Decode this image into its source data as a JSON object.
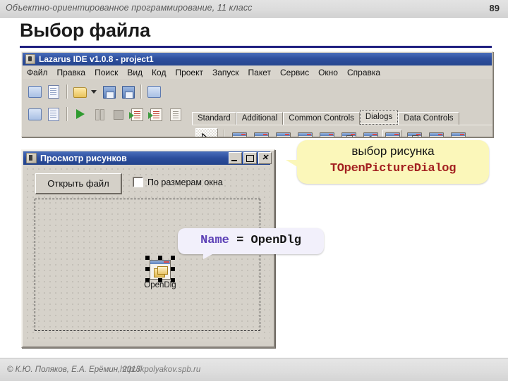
{
  "header": {
    "subject": "Объектно-ориентированное программирование, 11 класс",
    "page_number": "89"
  },
  "slide": {
    "title": "Выбор файла"
  },
  "footer": {
    "copyright": "© К.Ю. Поляков, Е.А. Ерёмин, 2013",
    "url": "http://kpolyakov.spb.ru"
  },
  "ide": {
    "title": "Lazarus IDE v1.0.8 - project1",
    "menu": [
      {
        "label": "Файл"
      },
      {
        "label": "Правка"
      },
      {
        "label": "Поиск"
      },
      {
        "label": "Вид"
      },
      {
        "label": "Код"
      },
      {
        "label": "Проект"
      },
      {
        "label": "Запуск"
      },
      {
        "label": "Пакет"
      },
      {
        "label": "Сервис"
      },
      {
        "label": "Окно"
      },
      {
        "label": "Справка"
      }
    ],
    "palette": {
      "tabs": [
        {
          "label": "Standard",
          "selected": false
        },
        {
          "label": "Additional",
          "selected": false
        },
        {
          "label": "Common Controls",
          "selected": false
        },
        {
          "label": "Dialogs",
          "selected": true
        },
        {
          "label": "Data Controls",
          "selected": false
        }
      ],
      "pointer_tool": "arrow-pointer-icon",
      "items": [
        {
          "name": "open-dialog-icon",
          "selected": false
        },
        {
          "name": "save-dialog-icon",
          "selected": false
        },
        {
          "name": "select-directory-dialog-icon",
          "selected": false
        },
        {
          "name": "color-dialog-icon",
          "selected": false
        },
        {
          "name": "font-dialog-icon",
          "selected": false
        },
        {
          "name": "print-dialog-icon",
          "selected": false
        },
        {
          "name": "printer-setup-dialog-icon",
          "selected": false
        },
        {
          "name": "open-picture-dialog-icon",
          "selected": true
        },
        {
          "name": "save-picture-dialog-icon",
          "selected": false
        },
        {
          "name": "calendar-dialog-icon",
          "selected": false
        },
        {
          "name": "page-setup-dialog-icon",
          "selected": false
        }
      ]
    },
    "toolbar_row1": [
      "new-unit-icon",
      "new-form-icon",
      "open-file-icon",
      "open-dropdown-caret",
      "save-icon",
      "save-all-icon",
      "toggle-form-unit-icon"
    ],
    "toolbar_row2": [
      "new-unit-alt-icon",
      "new-form-alt-icon",
      "run-icon",
      "pause-icon",
      "stop-icon",
      "step-into-icon",
      "step-over-icon",
      "step-out-icon"
    ]
  },
  "form": {
    "title": "Просмотр рисунков",
    "window_buttons": {
      "minimize": "minimize-icon",
      "maximize": "maximize-icon",
      "close": "close-icon"
    },
    "open_button": "Открыть файл",
    "checkbox": {
      "label": "По размерам окна",
      "checked": false
    },
    "component": {
      "label": "OpenDlg",
      "selected": true
    }
  },
  "callouts": {
    "dialog": {
      "line1": "выбор рисунка",
      "line2": "TOpenPictureDialog",
      "bg": "#fbf7ba",
      "line2_color": "#a32020"
    },
    "name": {
      "key": "Name",
      "value": "= OpenDlg",
      "bg": "#f2f0fb",
      "key_color": "#5b3fb5"
    }
  },
  "colors": {
    "title_rule": "#202080",
    "ide_titlebar": "#2e4f9e",
    "form_face": "#d4d0c8"
  }
}
